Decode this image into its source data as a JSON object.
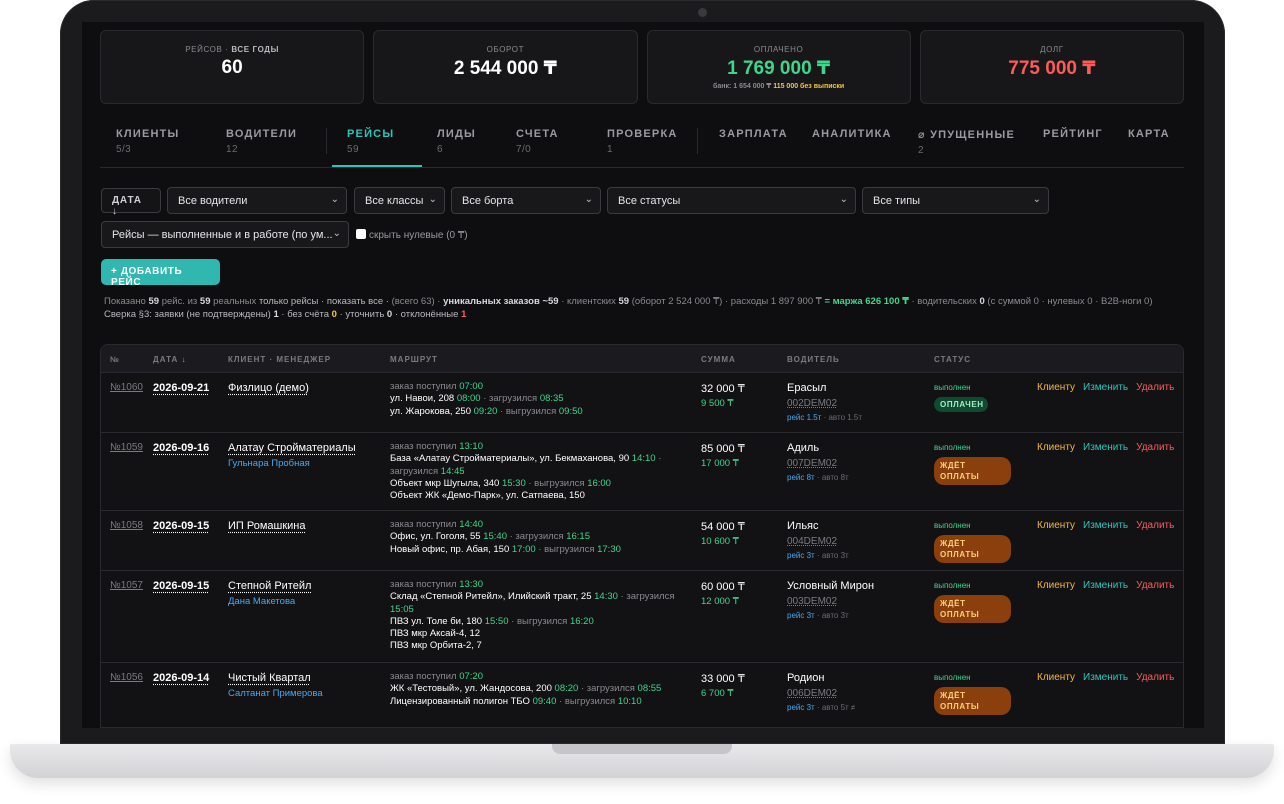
{
  "stats": [
    {
      "label": "РЕЙСОВ",
      "label_extra": "все годы",
      "value": "60",
      "color": "#ffffff"
    },
    {
      "label": "ОБОРОТ",
      "value": "2 544 000 ₸",
      "color": "#ffffff"
    },
    {
      "label": "ОПЛАЧЕНО",
      "value": "1 769 000 ₸",
      "color": "#3fd68b",
      "sub_prefix": "банк:",
      "sub_bank": "1 654 000 ₸",
      "sub_unbilled": "115 000 без выписки"
    },
    {
      "label": "ДОЛГ",
      "value": "775 000 ₸",
      "color": "#ff5a5a"
    }
  ],
  "tabs": [
    {
      "label": "КЛИЕНТЫ",
      "count": "5/3"
    },
    {
      "label": "ВОДИТЕЛИ",
      "count": "12"
    },
    {
      "label": "РЕЙСЫ",
      "count": "59",
      "active": true
    },
    {
      "label": "ЛИДЫ",
      "count": "6"
    },
    {
      "label": "СЧЕТА",
      "count": "7/0"
    },
    {
      "label": "ПРОВЕРКА",
      "count": "1"
    },
    {
      "label": "ЗАРПЛАТА",
      "count": ""
    },
    {
      "label": "АНАЛИТИКА",
      "count": ""
    },
    {
      "label": "⌀ УПУЩЕННЫЕ",
      "count": "2"
    },
    {
      "label": "РЕЙТИНГ",
      "count": ""
    },
    {
      "label": "КАРТА",
      "count": ""
    }
  ],
  "filters": {
    "date_button": "ДАТА ↓",
    "drivers": "Все водители",
    "classes": "Все классы",
    "boards": "Все борта",
    "statuses": "Все статусы",
    "types": "Все типы",
    "mode": "Рейсы — выполненные и в работе (по ум...",
    "hide_zero": "скрыть нулевые (0 ₸)"
  },
  "add_button": "+ ДОБАВИТЬ РЕЙС",
  "summary": {
    "shown_prefix": "Показано",
    "shown": "59",
    "shown_mid": "рейс. из",
    "total": "59",
    "shown_suffix": "реальных",
    "only_trips": "только рейсы",
    "show_all": "· показать все ·",
    "all_count": "(всего 63) ·",
    "unique": "уникальных заказов ~59",
    "clients_label": "· клиентских",
    "clients": "59",
    "turnover": "(оборот 2 524 000 ₸) · расходы 1 897 900 ₸",
    "margin": "= маржа 626 100 ₸",
    "drivers_label": "· водительских",
    "drivers": "0",
    "tail": "(с суммой 0 · нулевых 0 · B2B-ноги 0)",
    "line2_prefix": "Сверка §3: заявки (не подтверждены)",
    "unconfirmed": "1",
    "no_invoice_label": "· без счёта",
    "no_invoice": "0",
    "clarify_label": "· уточнить",
    "clarify": "0",
    "rejected_label": "· отклонённые",
    "rejected": "1"
  },
  "table": {
    "headers": {
      "num": "№",
      "date": "ДАТА",
      "date_arrow": "↓",
      "client": "КЛИЕНТ · МЕНЕДЖЕР",
      "route": "МАРШРУТ",
      "sum": "СУММА",
      "driver": "ВОДИТЕЛЬ",
      "status": "СТАТУС"
    },
    "actions": {
      "client": "Клиенту",
      "edit": "Изменить",
      "delete": "Удалить"
    },
    "rows": [
      {
        "num": "№1060",
        "date": "2026-09-21",
        "client": "Физлицо (демо)",
        "manager": "",
        "order_label": "заказ поступил",
        "order_time": "07:00",
        "stops": [
          {
            "addr": "ул. Навои, 208",
            "t1": "08:00",
            "l2": "загрузился",
            "t2": "08:35"
          },
          {
            "addr": "ул. Жарокова, 250",
            "t1": "09:20",
            "l2": "выгрузился",
            "t2": "09:50"
          }
        ],
        "sum": "32 000 ₸",
        "margin": "9 500 ₸",
        "driver": "Ерасыл",
        "plate": "002DEM02",
        "trip_label": "рейс 1.5т",
        "auto_label": "авто 1.5т",
        "status": "выполнен",
        "badge": "ОПЛАЧЕН",
        "badge_type": "paid"
      },
      {
        "num": "№1059",
        "date": "2026-09-16",
        "client": "Алатау Стройматериалы",
        "manager": "Гульнара Пробная",
        "order_label": "заказ поступил",
        "order_time": "13:10",
        "stops": [
          {
            "addr": "База «Алатау Стройматериалы», ул. Бекмаханова, 90",
            "t1": "14:10",
            "l2": "загрузился",
            "t2": "14:45"
          },
          {
            "addr": "Объект мкр Шугыла, 340",
            "t1": "15:30",
            "l2": "выгрузился",
            "t2": "16:00"
          },
          {
            "addr": "Объект ЖК «Демо-Парк», ул. Сатпаева, 150",
            "t1": "",
            "l2": "",
            "t2": ""
          }
        ],
        "sum": "85 000 ₸",
        "margin": "17 000 ₸",
        "driver": "Адиль",
        "plate": "007DEM02",
        "trip_label": "рейс 8т",
        "auto_label": "авто 8т",
        "status": "выполнен",
        "badge": "ЖДЁТ ОПЛАТЫ",
        "badge_type": "wait"
      },
      {
        "num": "№1058",
        "date": "2026-09-15",
        "client": "ИП Ромашкина",
        "manager": "",
        "order_label": "заказ поступил",
        "order_time": "14:40",
        "stops": [
          {
            "addr": "Офис, ул. Гоголя, 55",
            "t1": "15:40",
            "l2": "загрузился",
            "t2": "16:15"
          },
          {
            "addr": "Новый офис, пр. Абая, 150",
            "t1": "17:00",
            "l2": "выгрузился",
            "t2": "17:30"
          }
        ],
        "sum": "54 000 ₸",
        "margin": "10 600 ₸",
        "driver": "Ильяс",
        "plate": "004DEM02",
        "trip_label": "рейс 3т",
        "auto_label": "авто 3т",
        "status": "выполнен",
        "badge": "ЖДЁТ ОПЛАТЫ",
        "badge_type": "wait"
      },
      {
        "num": "№1057",
        "date": "2026-09-15",
        "client": "Степной Ритейл",
        "manager": "Дана Макетова",
        "order_label": "заказ поступил",
        "order_time": "13:30",
        "stops": [
          {
            "addr": "Склад «Степной Ритейл», Илийский тракт, 25",
            "t1": "14:30",
            "l2": "загрузился",
            "t2": "15:05"
          },
          {
            "addr": "ПВЗ ул. Толе би, 180",
            "t1": "15:50",
            "l2": "выгрузился",
            "t2": "16:20"
          },
          {
            "addr": "ПВЗ мкр Аксай-4, 12",
            "t1": "",
            "l2": "",
            "t2": ""
          },
          {
            "addr": "ПВЗ мкр Орбита-2, 7",
            "t1": "",
            "l2": "",
            "t2": ""
          }
        ],
        "sum": "60 000 ₸",
        "margin": "12 000 ₸",
        "driver": "Условный Мирон",
        "plate": "003DEM02",
        "trip_label": "рейс 3т",
        "auto_label": "авто 3т",
        "status": "выполнен",
        "badge": "ЖДЁТ ОПЛАТЫ",
        "badge_type": "wait"
      },
      {
        "num": "№1056",
        "date": "2026-09-14",
        "client": "Чистый Квартал",
        "manager": "Салтанат Примерова",
        "order_label": "заказ поступил",
        "order_time": "07:20",
        "stops": [
          {
            "addr": "ЖК «Тестовый», ул. Жандосова, 200",
            "t1": "08:20",
            "l2": "загрузился",
            "t2": "08:55"
          },
          {
            "addr": "Лицензированный полигон ТБО",
            "t1": "09:40",
            "l2": "выгрузился",
            "t2": "10:10"
          }
        ],
        "sum": "33 000 ₸",
        "margin": "6 700 ₸",
        "driver": "Родион",
        "plate": "006DEM02",
        "trip_label": "рейс 3т",
        "auto_label": "авто 5т ≠",
        "status": "выполнен",
        "badge": "ЖДЁТ ОПЛАТЫ",
        "badge_type": "wait"
      }
    ]
  }
}
